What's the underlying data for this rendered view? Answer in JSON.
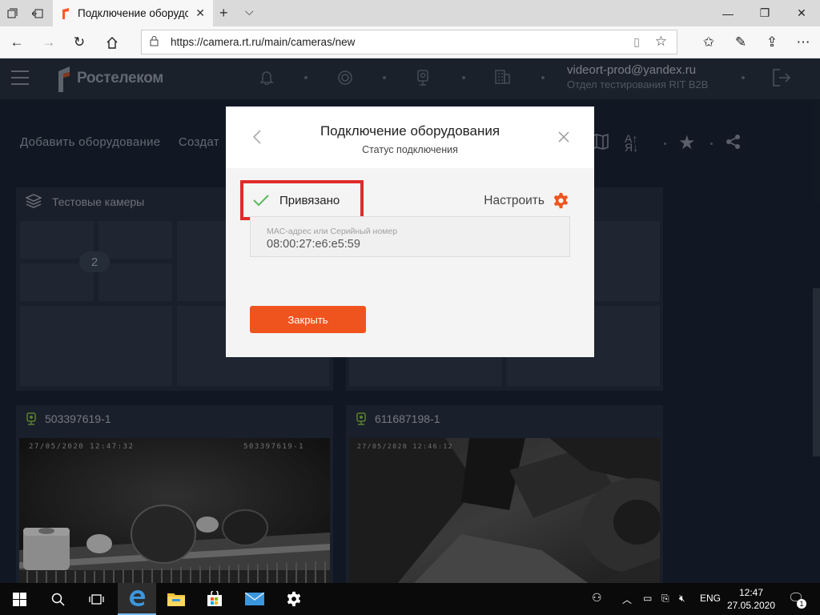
{
  "browser": {
    "tab_title": "Подключение оборудс",
    "url": "https://camera.rt.ru/main/cameras/new"
  },
  "site": {
    "brand": "Ростелеком",
    "user_email": "videort-prod@yandex.ru",
    "user_org": "Отдел тестирования RIT B2B",
    "actions": [
      "Добавить оборудование",
      "Создат"
    ]
  },
  "groups": {
    "test_cameras": {
      "title": "Тестовые камеры",
      "count": "2"
    }
  },
  "cameras": [
    {
      "name": "503397619-1",
      "osd_date": "27/05/2020 12:47:32",
      "osd_id": "503397619-1"
    },
    {
      "name": "611687198-1",
      "osd_date": "27/05/2020 12:46:12"
    }
  ],
  "modal": {
    "title": "Подключение оборудования",
    "subtitle": "Статус подключения",
    "status": "Привязано",
    "configure": "Настроить",
    "mac_label": "MAC-адрес или Серийный номер",
    "mac_value": "08:00:27:e6:e5:59",
    "close_button": "Закрыть"
  },
  "taskbar": {
    "lang": "ENG",
    "time": "12:47",
    "date": "27.05.2020",
    "notifications": "1"
  },
  "colors": {
    "accent": "#f0541e",
    "highlight": "#e02b2b",
    "check": "#4caf50",
    "page_bg": "#1c2636"
  }
}
